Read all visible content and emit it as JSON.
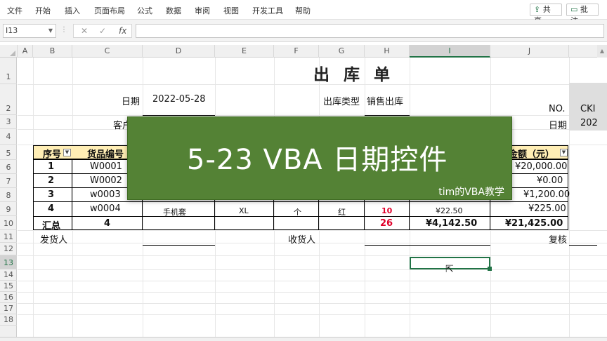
{
  "ribbon": {
    "tabs": [
      "文件",
      "开始",
      "插入",
      "页面布局",
      "公式",
      "数据",
      "审阅",
      "视图",
      "开发工具",
      "帮助"
    ],
    "share_label": "共享",
    "comments_label": "批注"
  },
  "formula_bar": {
    "name_box": "I13",
    "fx": "fx",
    "formula": ""
  },
  "columns": [
    "A",
    "B",
    "C",
    "D",
    "E",
    "F",
    "G",
    "H",
    "I",
    "J"
  ],
  "selected_column": "I",
  "rows": [
    "1",
    "2",
    "3",
    "4",
    "5",
    "6",
    "7",
    "8",
    "9",
    "10",
    "11",
    "12",
    "13",
    "14",
    "15",
    "16",
    "17",
    "18"
  ],
  "selected_row": "13",
  "sheet": {
    "title": "出 库 单",
    "date_label": "日期",
    "date_value": "2022-05-28",
    "outtype_label": "出库类型",
    "outtype_value": "销售出库",
    "customer_label": "客户",
    "no_label": "NO.",
    "no_value": "CKI",
    "date2_label": "日期",
    "date2_value": "202",
    "header": {
      "seq": "序号",
      "code": "货品编号",
      "amount": "金额（元）"
    },
    "items": [
      {
        "seq": "1",
        "code": "W0001",
        "amount": "¥20,000.00"
      },
      {
        "seq": "2",
        "code": "W0002",
        "amount": "¥0.00"
      },
      {
        "seq": "3",
        "code": "w0003",
        "amount": "¥1,200.00"
      },
      {
        "seq": "4",
        "code": "w0004",
        "amount": "¥225.00"
      }
    ],
    "partial_row9": {
      "d": "手机套",
      "e": "XL",
      "f": "个",
      "g": "红",
      "h": "10",
      "i": "¥22.50"
    },
    "total": {
      "label": "汇总",
      "count": "4",
      "qty": "26",
      "price_total": "¥4,142.50",
      "amount_total": "¥21,425.00"
    },
    "sender_label": "发货人",
    "receiver_label": "收货人",
    "reviewer_label": "复核"
  },
  "overlay": {
    "title": "5-23 VBA 日期控件",
    "subtitle": "tim的VBA教学"
  },
  "colors": {
    "banner": "#548235",
    "header_fill": "#ffeeb5",
    "accent": "#217346",
    "red": "#e0002a"
  }
}
